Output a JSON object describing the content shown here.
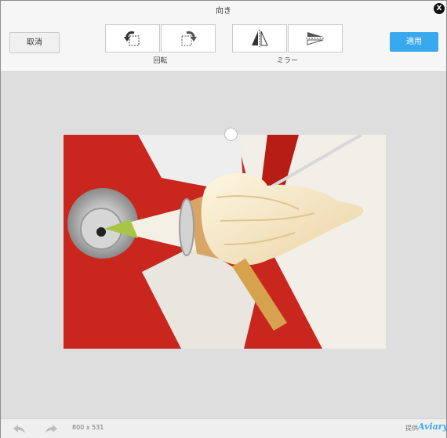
{
  "window": {
    "title": "向き"
  },
  "toolbar": {
    "cancel_label": "取消",
    "apply_label": "適用",
    "rotate_label": "回転",
    "mirror_label": "ミラー",
    "icons": {
      "rotate_left": "rotate-left-icon",
      "rotate_right": "rotate-right-icon",
      "flip_horizontal": "flip-horizontal-icon",
      "flip_vertical": "flip-vertical-icon",
      "close": "close-icon"
    }
  },
  "footer": {
    "image_size": "800 x 531",
    "credit_label": "提供",
    "brand": "Aviary"
  },
  "colors": {
    "accent": "#39a9ef",
    "photo_red": "#c9271d",
    "background": "#dedede"
  }
}
